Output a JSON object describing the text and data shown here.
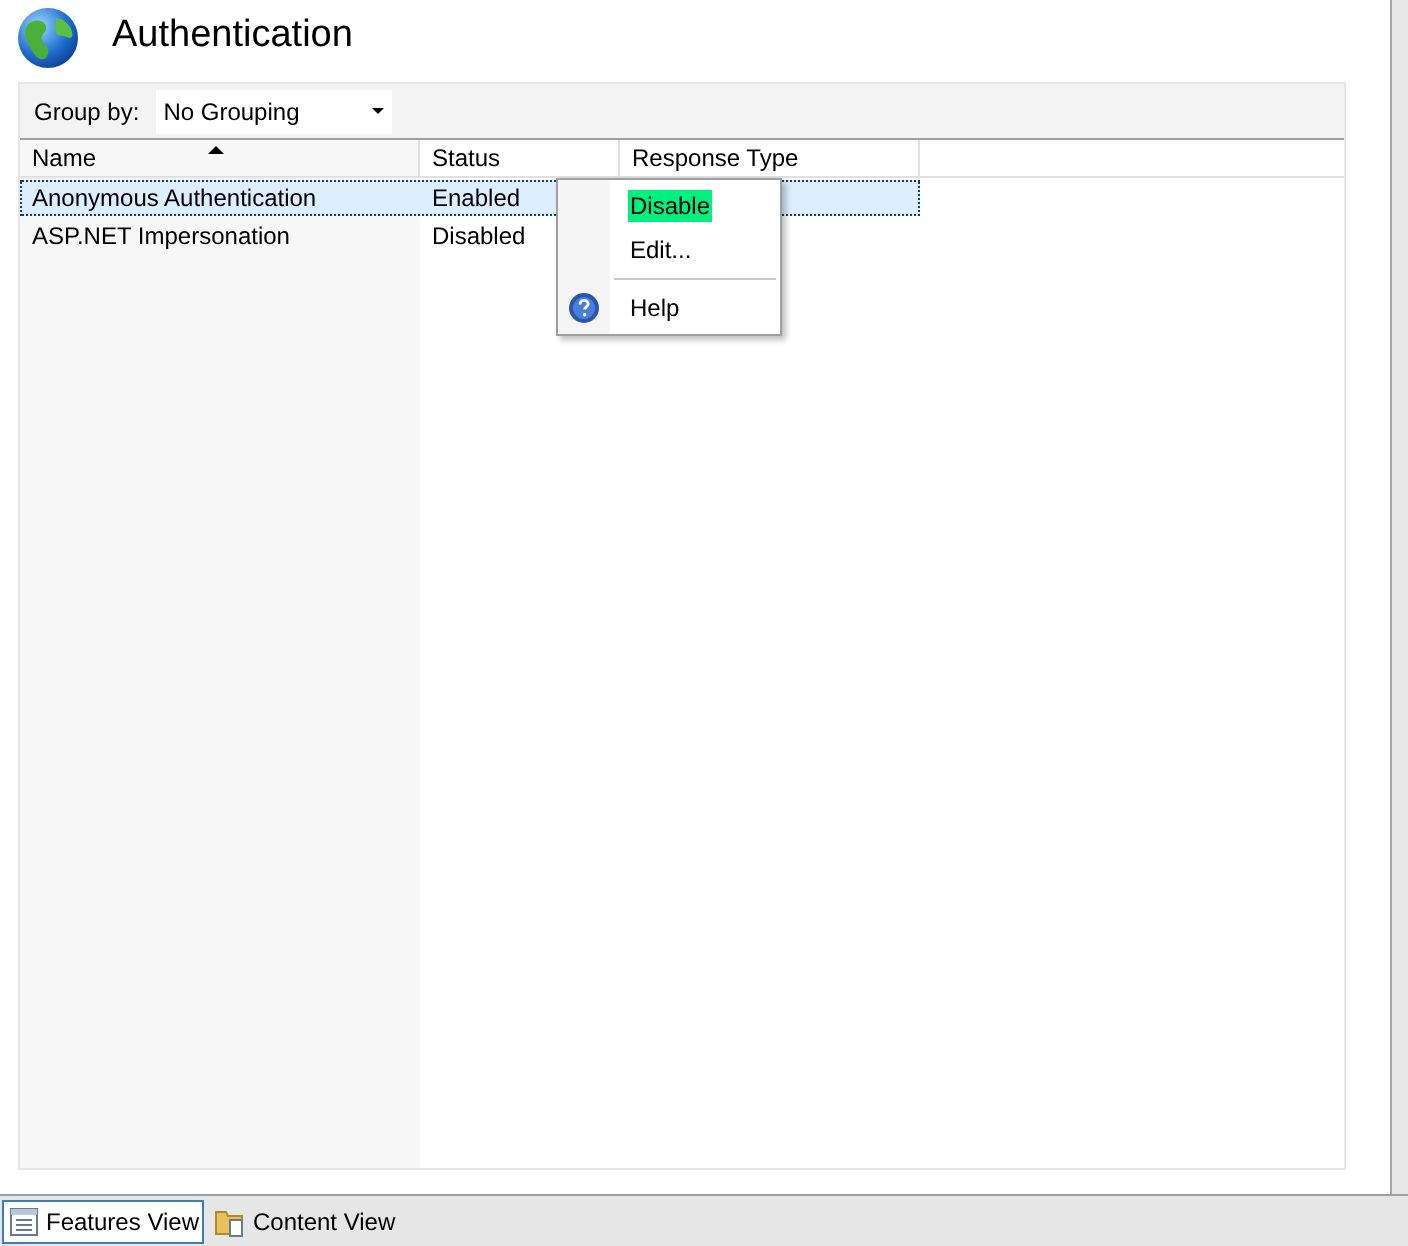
{
  "title": "Authentication",
  "group_by": {
    "label": "Group by:",
    "value": "No Grouping"
  },
  "columns": [
    {
      "label": "Name",
      "sorted": true
    },
    {
      "label": "Status",
      "sorted": false
    },
    {
      "label": "Response Type",
      "sorted": false
    }
  ],
  "rows": [
    {
      "cells": [
        "Anonymous Authentication",
        "Enabled"
      ],
      "selected": true
    },
    {
      "cells": [
        "ASP.NET Impersonation",
        "Disabled"
      ],
      "selected": false
    }
  ],
  "context_menu": [
    {
      "kind": "item",
      "label": "Disable",
      "highlighted": true
    },
    {
      "kind": "item",
      "label": "Edit...",
      "highlighted": false
    },
    {
      "kind": "separator"
    },
    {
      "kind": "help",
      "label": "Help",
      "highlighted": false
    }
  ],
  "views": [
    {
      "label": "Features View",
      "selected": true,
      "kind": "features"
    },
    {
      "label": "Content View",
      "selected": false,
      "kind": "content"
    }
  ]
}
